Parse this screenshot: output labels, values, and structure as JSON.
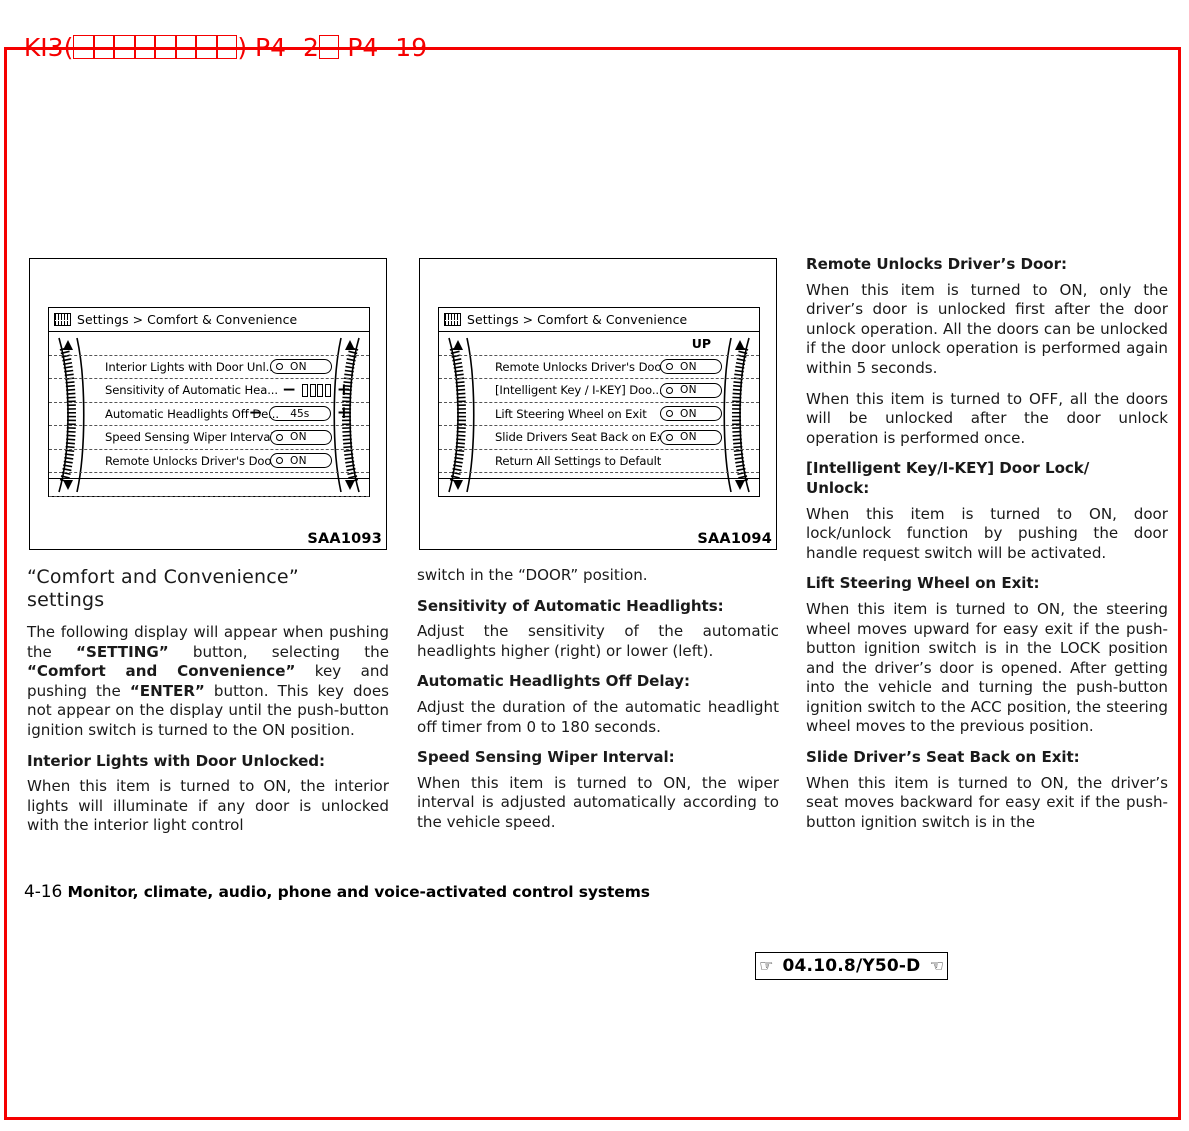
{
  "print_header": {
    "prefix": "KI3(",
    "tofu_count_1": 4,
    "middle": "",
    "tofu_count_2": 4,
    "suffix": ") P4- 2",
    "tofu_after": 1,
    "tail": " P4- 19",
    "color": "#f50000",
    "full_text": "KI3(□□□□ □□□□) P4- 2□ P4- 19"
  },
  "frame": {
    "color": "#f50000"
  },
  "figures": [
    {
      "caption": "SAA1093",
      "screen": {
        "icon": "lcd-display-icon",
        "title": "Settings > Comfort & Convenience",
        "up_label": "",
        "rows": [
          {
            "label": "Interior Lights with Door Unl...",
            "control": "toggle",
            "value": "ON"
          },
          {
            "label": "Sensitivity of Automatic Hea...",
            "control": "bars",
            "minus": "−",
            "plus": "+",
            "segments": 4
          },
          {
            "label": "Automatic Headlights Off De...",
            "control": "stepper",
            "minus": "−",
            "plus": "+",
            "value": "45s"
          },
          {
            "label": "Speed Sensing Wiper Interval",
            "control": "toggle",
            "value": "ON"
          },
          {
            "label": "Remote Unlocks Driver's Doo...",
            "control": "toggle",
            "value": "ON"
          }
        ]
      }
    },
    {
      "caption": "SAA1094",
      "screen": {
        "icon": "lcd-display-icon",
        "title": "Settings > Comfort & Convenience",
        "up_label": "UP",
        "rows": [
          {
            "label": "Remote Unlocks Driver's Doo...",
            "control": "toggle",
            "value": "ON"
          },
          {
            "label": "[Intelligent Key / I-KEY] Doo...",
            "control": "toggle",
            "value": "ON"
          },
          {
            "label": "Lift Steering Wheel on Exit",
            "control": "toggle",
            "value": "ON"
          },
          {
            "label": "Slide Drivers Seat Back on Exit",
            "control": "toggle",
            "value": "ON"
          },
          {
            "label": "Return All Settings to Default",
            "control": "none",
            "value": ""
          }
        ]
      }
    }
  ],
  "column1": {
    "section_title_line1": "“Comfort and Convenience”",
    "section_title_line2": "settings",
    "para_intro_html": "The following display will appear when pushing the <b>“SETTING”</b> button, selecting the <b>“Comfort and Convenience”</b> key and pushing the <b>“ENTER”</b> button. This key does not appear on the display until the push-button ignition switch is turned to the ON position.",
    "head_interior": "Interior Lights with Door Unlocked:",
    "para_interior": "When this item is turned to ON, the interior lights will illuminate if any door is unlocked with the interior light control"
  },
  "column2": {
    "para_continued": "switch in the “DOOR” position.",
    "head_sensitivity": "Sensitivity of Automatic Headlights:",
    "para_sensitivity": "Adjust the sensitivity of the automatic headlights higher (right) or lower (left).",
    "head_offdelay": "Automatic Headlights Off Delay:",
    "para_offdelay": "Adjust the duration of the automatic headlight off timer from 0 to 180 seconds.",
    "head_wiper": "Speed Sensing Wiper Interval:",
    "para_wiper": "When this item is turned to ON, the wiper interval is adjusted automatically according to the vehicle speed."
  },
  "column3": {
    "head_remote": "Remote Unlocks Driver’s Door:",
    "para_remote_on": "When this item is turned to ON, only the driver’s door is unlocked first after the door unlock operation. All the doors can be unlocked if the door unlock operation is performed again within 5 seconds.",
    "para_remote_off": "When this item is turned to OFF, all the doors will be unlocked after the door unlock operation is performed once.",
    "head_ikey_line1": "[Intelligent Key/I-KEY] Door Lock/",
    "head_ikey_line2": "Unlock:",
    "para_ikey": "When this item is turned to ON, door lock/unlock function by pushing the door handle request switch will be activated.",
    "head_lift": "Lift Steering Wheel on Exit:",
    "para_lift": "When this item is turned to ON, the steering wheel moves upward for easy exit if the push-button ignition switch is in the LOCK position and the driver’s door is opened. After getting into the vehicle and turning the push-button ignition switch to the ACC position, the steering wheel moves to the previous position.",
    "head_slide": "Slide Driver’s Seat Back on Exit:",
    "para_slide": "When this item is turned to ON, the driver’s seat moves backward for easy exit if the push-button ignition switch is in the"
  },
  "footer": {
    "page_number": "4-16",
    "chapter_title": "Monitor, climate, audio, phone and voice-activated control systems"
  },
  "date_stamp": {
    "hand_left": "☞",
    "text": "04.10.8/Y50-D",
    "hand_right": "☜"
  }
}
